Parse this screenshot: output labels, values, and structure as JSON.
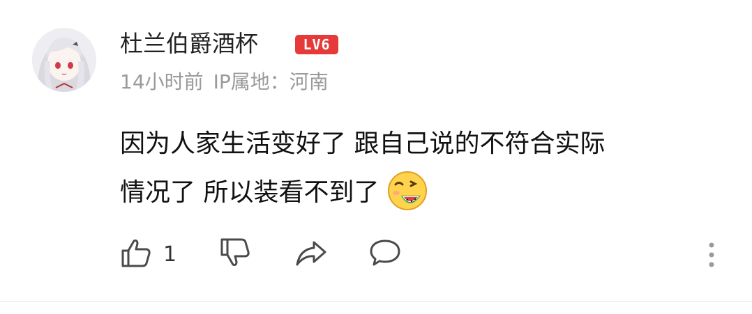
{
  "comment": {
    "user": {
      "name": "杜兰伯爵酒杯",
      "level_badge": "LV6"
    },
    "meta": {
      "time": "14小时前",
      "location": "IP属地：河南"
    },
    "body": {
      "line1": "因为人家生活变好了 跟自己说的不符合实际",
      "line2": "情况了 所以装看不到了",
      "emoji": "eating-watermelon-emoji"
    },
    "actions": {
      "like_count": "1",
      "icons": [
        "thumbs-up-icon",
        "thumbs-down-icon",
        "share-icon",
        "comment-icon",
        "more-icon"
      ]
    }
  },
  "colors": {
    "badge": "#e6393a",
    "username": "#222222",
    "meta": "#9a9a9a",
    "body": "#111111",
    "icon": "#4a4a4a"
  }
}
